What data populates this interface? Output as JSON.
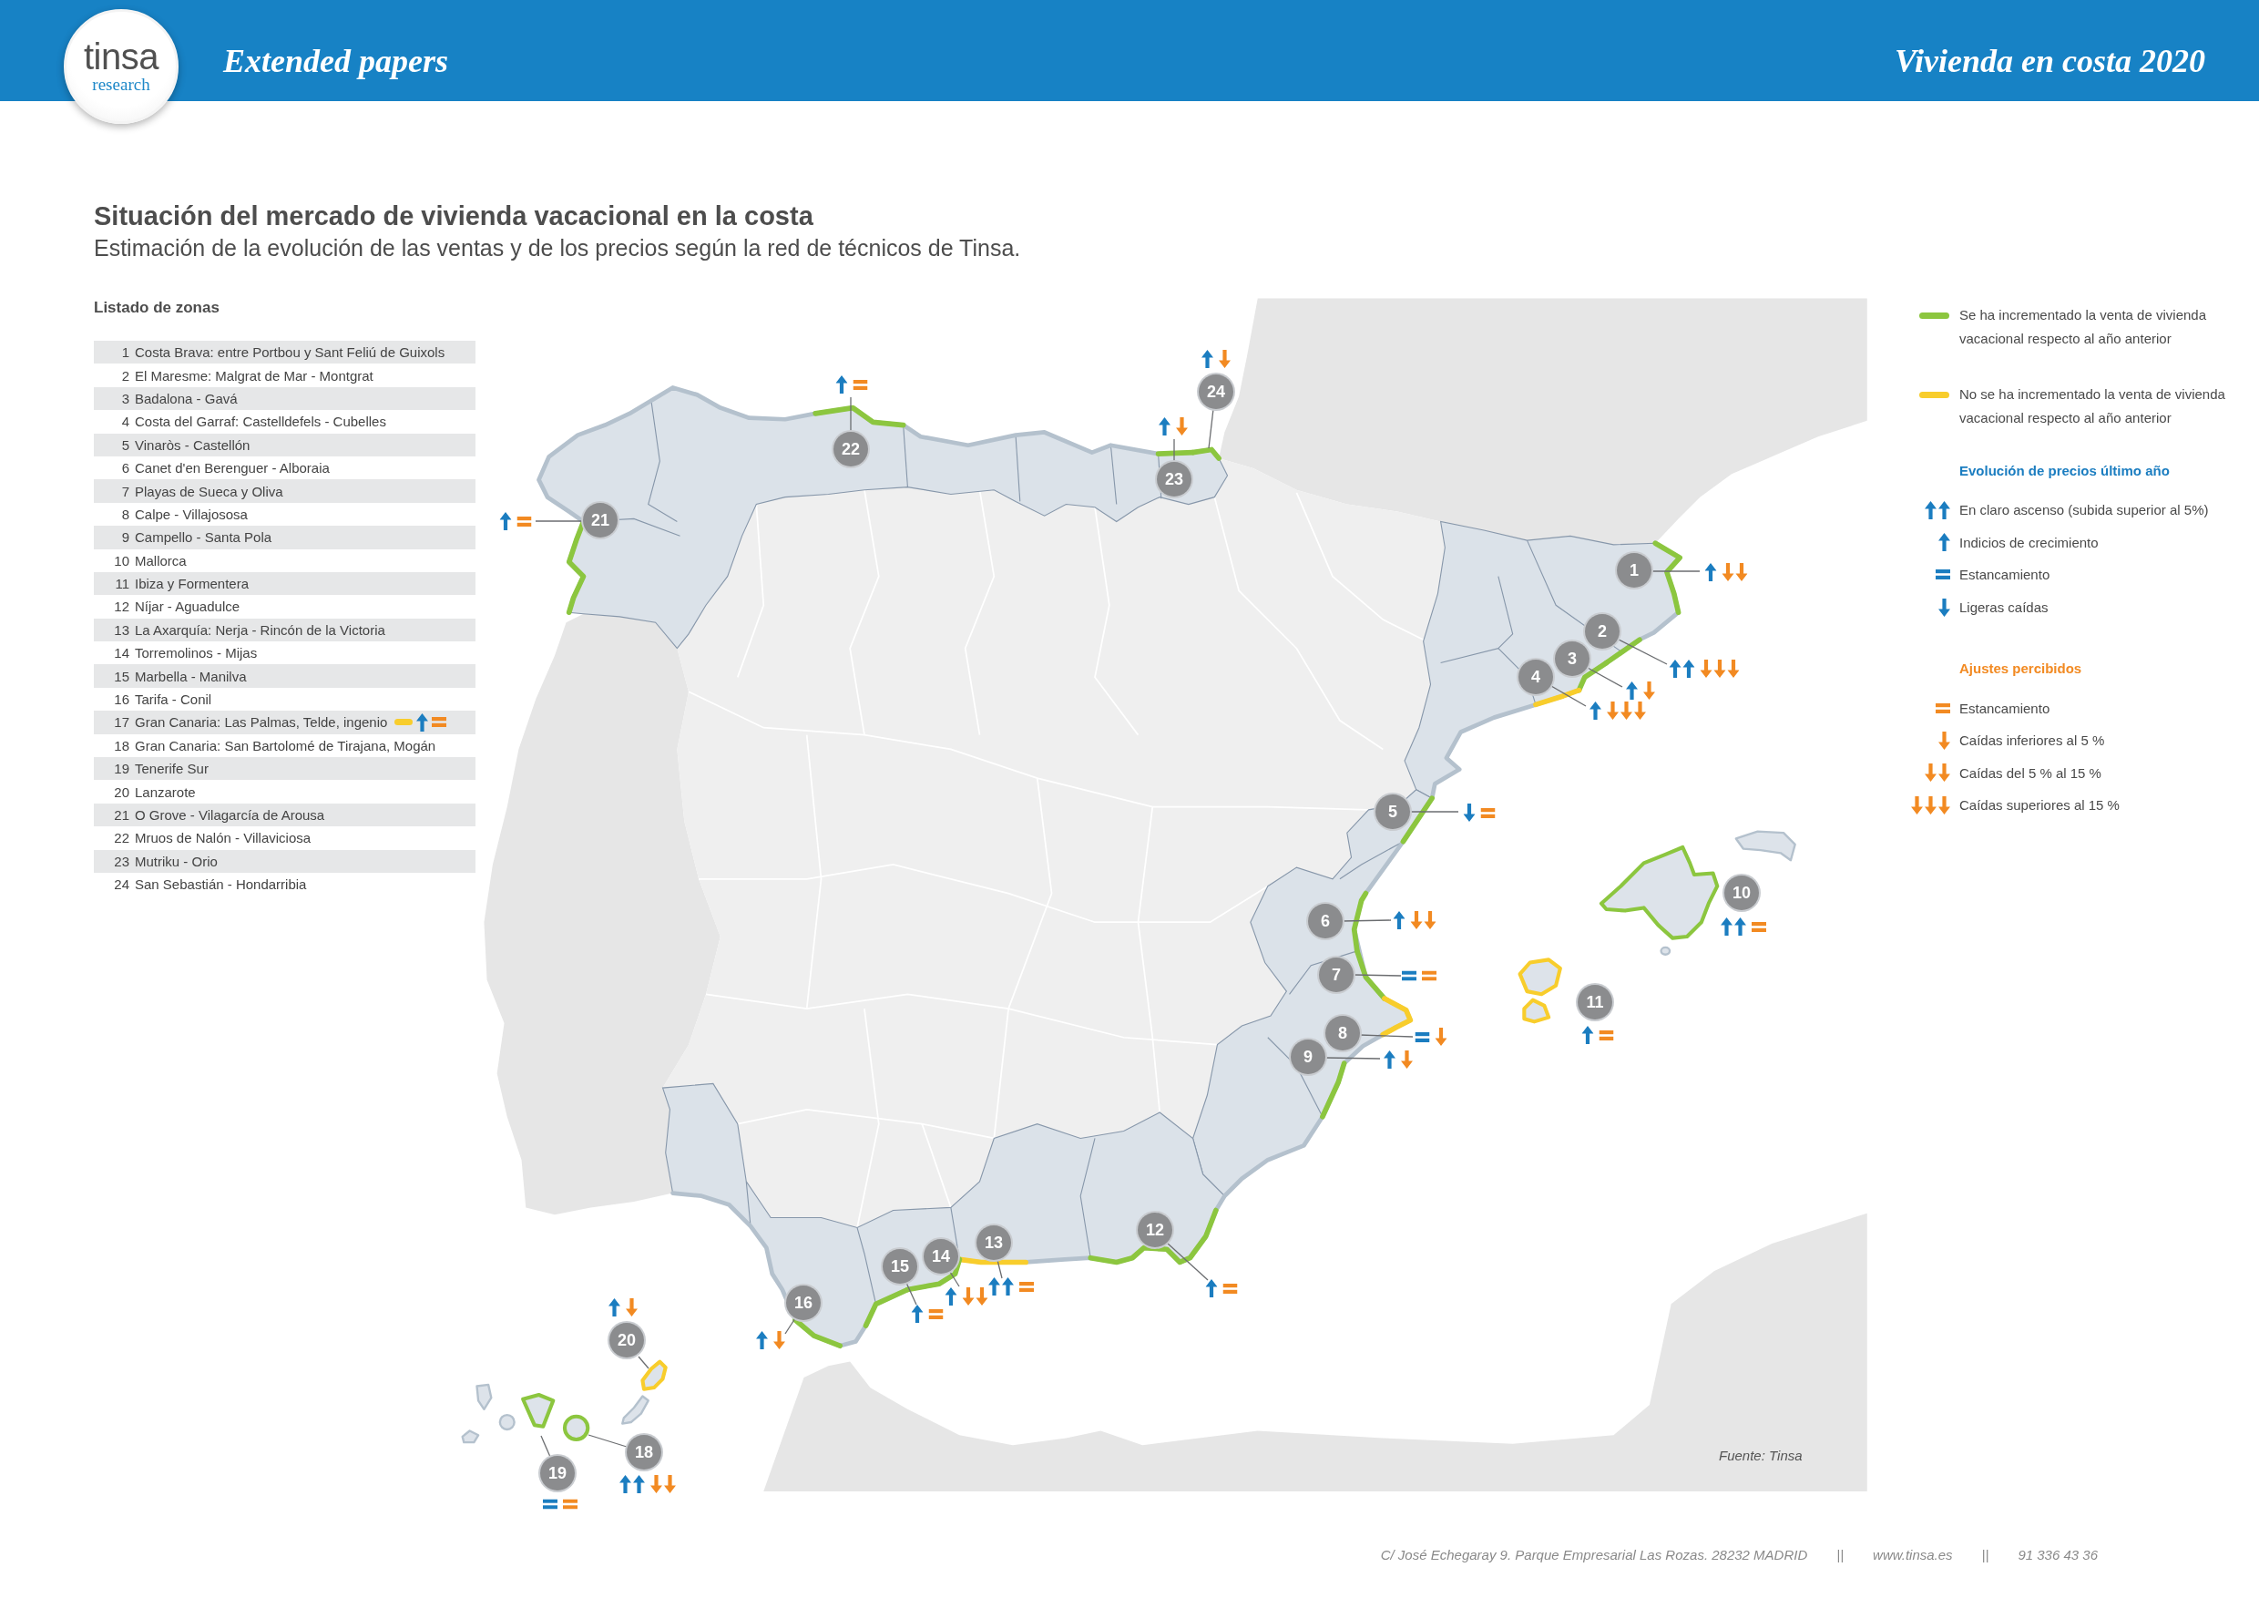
{
  "header": {
    "logo": {
      "wordmark": "tinsa",
      "tagline": "research"
    },
    "series": "Extended papers",
    "title": "Vivienda en costa 2020"
  },
  "heading": {
    "title": "Situación del mercado de vivienda vacacional en la costa",
    "subtitle": "Estimación de la evolución de las ventas y de los precios según la red de técnicos de Tinsa."
  },
  "zones_list": {
    "title": "Listado de zonas",
    "items": [
      {
        "number": "1",
        "name": "Costa Brava: entre Portbou y Sant Feliú de Guixols"
      },
      {
        "number": "2",
        "name": "El Maresme: Malgrat de Mar - Montgrat"
      },
      {
        "number": "3",
        "name": "Badalona - Gavá"
      },
      {
        "number": "4",
        "name": "Costa del Garraf: Castelldefels - Cubelles"
      },
      {
        "number": "5",
        "name": "Vinaròs - Castellón"
      },
      {
        "number": "6",
        "name": "Canet d'en Berenguer - Alboraia"
      },
      {
        "number": "7",
        "name": "Playas de Sueca y Oliva"
      },
      {
        "number": "8",
        "name": "Calpe - Villajososa"
      },
      {
        "number": "9",
        "name": "Campello - Santa Pola"
      },
      {
        "number": "10",
        "name": "Mallorca"
      },
      {
        "number": "11",
        "name": "Ibiza y Formentera"
      },
      {
        "number": "12",
        "name": "Níjar - Aguadulce"
      },
      {
        "number": "13",
        "name": "La Axarquía: Nerja - Rincón de la Victoria"
      },
      {
        "number": "14",
        "name": "Torremolinos - Mijas"
      },
      {
        "number": "15",
        "name": "Marbella - Manilva"
      },
      {
        "number": "16",
        "name": "Tarifa - Conil"
      },
      {
        "number": "17",
        "name": "Gran Canaria: Las Palmas, Telde, ingenio",
        "indicators": {
          "sales_increased": false,
          "price": {
            "kind": "up"
          },
          "adjustment": {
            "kind": "flat"
          }
        }
      },
      {
        "number": "18",
        "name": "Gran Canaria: San Bartolomé de Tirajana, Mogán"
      },
      {
        "number": "19",
        "name": "Tenerife Sur"
      },
      {
        "number": "20",
        "name": "Lanzarote"
      },
      {
        "number": "21",
        "name": "O Grove - Vilagarcía de Arousa"
      },
      {
        "number": "22",
        "name": "Mruos de Nalón - Villaviciosa"
      },
      {
        "number": "23",
        "name": "Mutriku - Orio"
      },
      {
        "number": "24",
        "name": "San Sebastián - Hondarribia"
      }
    ]
  },
  "map": {
    "zones": [
      {
        "number": "1",
        "sales_increased": true,
        "price": {
          "kind": "up"
        },
        "adjustment": {
          "kind": "down_2"
        }
      },
      {
        "number": "2",
        "sales_increased": true,
        "price": {
          "kind": "strong_up"
        },
        "adjustment": {
          "kind": "down_3"
        }
      },
      {
        "number": "3",
        "sales_increased": true,
        "price": {
          "kind": "up"
        },
        "adjustment": {
          "kind": "down_1"
        }
      },
      {
        "number": "4",
        "sales_increased": false,
        "price": {
          "kind": "up"
        },
        "adjustment": {
          "kind": "down_3"
        }
      },
      {
        "number": "5",
        "sales_increased": true,
        "price": {
          "kind": "down"
        },
        "adjustment": {
          "kind": "flat"
        }
      },
      {
        "number": "6",
        "sales_increased": true,
        "price": {
          "kind": "up"
        },
        "adjustment": {
          "kind": "down_2"
        }
      },
      {
        "number": "7",
        "sales_increased": true,
        "price": {
          "kind": "flat"
        },
        "adjustment": {
          "kind": "flat"
        }
      },
      {
        "number": "8",
        "sales_increased": false,
        "price": {
          "kind": "flat"
        },
        "adjustment": {
          "kind": "down_1"
        }
      },
      {
        "number": "9",
        "sales_increased": true,
        "price": {
          "kind": "up"
        },
        "adjustment": {
          "kind": "down_1"
        }
      },
      {
        "number": "10",
        "sales_increased": true,
        "price": {
          "kind": "strong_up"
        },
        "adjustment": {
          "kind": "flat"
        }
      },
      {
        "number": "11",
        "sales_increased": false,
        "price": {
          "kind": "up"
        },
        "adjustment": {
          "kind": "flat"
        }
      },
      {
        "number": "12",
        "sales_increased": true,
        "price": {
          "kind": "up"
        },
        "adjustment": {
          "kind": "flat"
        }
      },
      {
        "number": "13",
        "sales_increased": false,
        "price": {
          "kind": "strong_up"
        },
        "adjustment": {
          "kind": "flat"
        }
      },
      {
        "number": "14",
        "sales_increased": true,
        "price": {
          "kind": "up"
        },
        "adjustment": {
          "kind": "down_2"
        }
      },
      {
        "number": "15",
        "sales_increased": true,
        "price": {
          "kind": "up"
        },
        "adjustment": {
          "kind": "flat"
        }
      },
      {
        "number": "16",
        "sales_increased": true,
        "price": {
          "kind": "up"
        },
        "adjustment": {
          "kind": "down_1"
        }
      },
      {
        "number": "18",
        "sales_increased": true,
        "price": {
          "kind": "strong_up"
        },
        "adjustment": {
          "kind": "down_2"
        }
      },
      {
        "number": "19",
        "sales_increased": true,
        "price": {
          "kind": "flat"
        },
        "adjustment": {
          "kind": "flat"
        }
      },
      {
        "number": "20",
        "sales_increased": false,
        "price": {
          "kind": "up"
        },
        "adjustment": {
          "kind": "down_1"
        }
      },
      {
        "number": "21",
        "sales_increased": true,
        "price": {
          "kind": "up"
        },
        "adjustment": {
          "kind": "flat"
        }
      },
      {
        "number": "22",
        "sales_increased": true,
        "price": {
          "kind": "up"
        },
        "adjustment": {
          "kind": "flat"
        }
      },
      {
        "number": "23",
        "sales_increased": true,
        "price": {
          "kind": "up"
        },
        "adjustment": {
          "kind": "down_1"
        }
      },
      {
        "number": "24",
        "sales_increased": true,
        "price": {
          "kind": "up"
        },
        "adjustment": {
          "kind": "down_1"
        }
      }
    ],
    "source": "Fuente: Tinsa"
  },
  "legend": {
    "sales": [
      {
        "sales_increased": true,
        "label": "Se ha incrementado la venta de vivienda vacacional respecto al año anterior"
      },
      {
        "sales_increased": false,
        "label": "No se ha incrementado la venta de vivienda vacacional respecto al año anterior"
      }
    ],
    "price_evolution": {
      "title": "Evolución de precios último año",
      "items": [
        {
          "kind": "strong_up",
          "label": "En claro ascenso (subida superior al 5%)"
        },
        {
          "kind": "up",
          "label": "Indicios de crecimiento"
        },
        {
          "kind": "flat",
          "label": "Estancamiento"
        },
        {
          "kind": "down",
          "label": "Ligeras caídas"
        }
      ]
    },
    "adjustments": {
      "title": "Ajustes percibidos",
      "items": [
        {
          "kind": "flat",
          "label": "Estancamiento"
        },
        {
          "kind": "down_1",
          "label": "Caídas inferiores al 5 %"
        },
        {
          "kind": "down_2",
          "label": "Caídas del 5 % al 15 %"
        },
        {
          "kind": "down_3",
          "label": "Caídas superiores al 15 %"
        }
      ]
    }
  },
  "footer": {
    "address": "C/ José Echegaray 9. Parque Empresarial Las Rozas. 28232 MADRID",
    "separators": [
      "||",
      "||"
    ],
    "website": "www.tinsa.es",
    "phone": "91 336 43 36"
  }
}
